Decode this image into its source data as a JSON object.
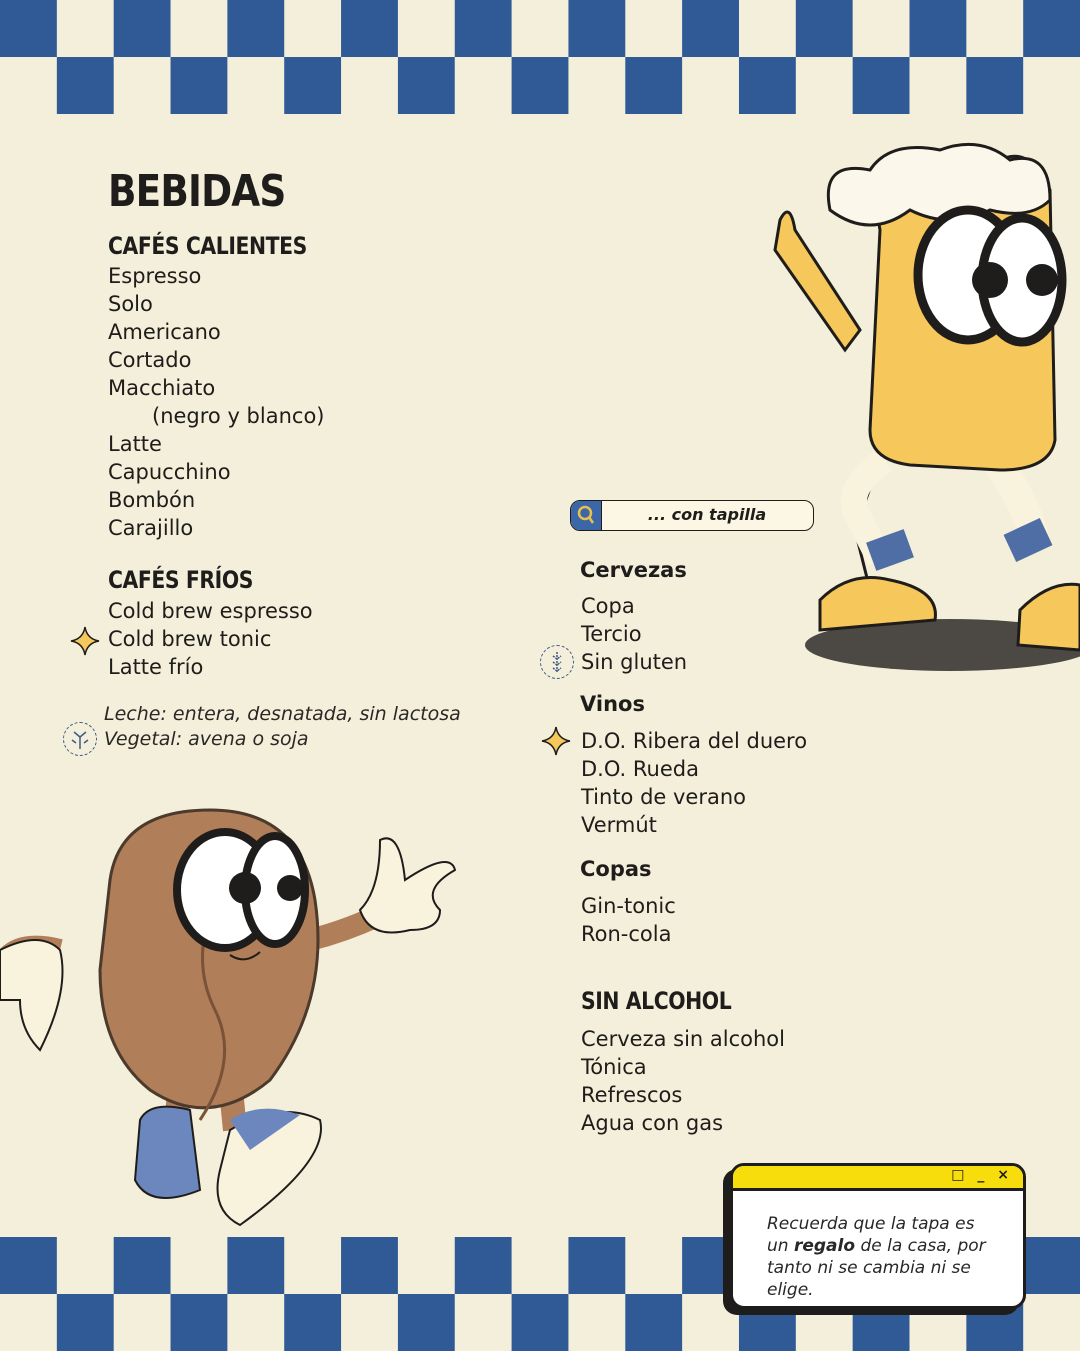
{
  "title": "BEBIDAS",
  "cafes_calientes": {
    "heading": "CAFÉS CALIENTES",
    "items": [
      "Espresso",
      "Solo",
      "Americano",
      "Cortado",
      "Macchiato",
      "(negro y blanco)",
      "Latte",
      "Capucchino",
      "Bombón",
      "Carajillo"
    ]
  },
  "cafes_frios": {
    "heading": "CAFÉS FRÍOS",
    "items": [
      "Cold brew espresso",
      "Cold brew tonic",
      "Latte frío"
    ],
    "highlight_icon": "sparkle-star-icon"
  },
  "milk_note": {
    "line1": "Leche: entera, desnatada, sin lactosa",
    "line2": "Vegetal: avena o soja",
    "icon": "plant-icon"
  },
  "search_bar": {
    "label": "... con tapilla",
    "icon": "search-icon"
  },
  "cervezas": {
    "heading": "Cervezas",
    "items": [
      "Copa",
      "Tercio",
      "Sin gluten"
    ],
    "icon": "gluten-free-icon"
  },
  "vinos": {
    "heading": "Vinos",
    "items": [
      "D.O. Ribera del duero",
      "D.O. Rueda",
      "Tinto de verano",
      "Vermút"
    ]
  },
  "copas": {
    "heading": "Copas",
    "items": [
      "Gin-tonic",
      "Ron-cola"
    ]
  },
  "sin_alcohol": {
    "heading": "SIN ALCOHOL",
    "items": [
      "Cerveza sin alcohol",
      "Tónica",
      "Refrescos",
      "Agua con gas"
    ]
  },
  "notice": {
    "before": "Recuerda que la tapa es un",
    "bold": "regalo",
    "after": "de la casa, por tanto ni se cambia ni se elige.",
    "controls": "□ _ ×"
  },
  "colors": {
    "background": "#f4efda",
    "checker_blue": "#2f5a96",
    "window_yellow": "#f7dd0b",
    "beer": "#f6c75a",
    "coffee_bean": "#b07e58"
  }
}
